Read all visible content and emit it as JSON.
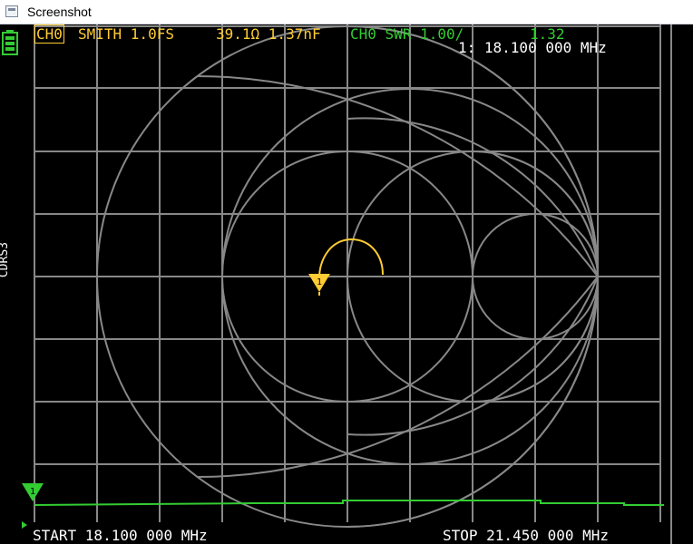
{
  "window": {
    "title": "Screenshot"
  },
  "header": {
    "trace_channel": "CH0",
    "trace_format": "SMITH 1.0FS",
    "trace_value": "39.1Ω 1.37nF",
    "swr_channel": "CH0",
    "swr_label": "SWR 1.00/",
    "swr_value": "1.32"
  },
  "marker": {
    "label": "1: 18.100 000 MHz",
    "number": "1"
  },
  "side_label": "CDRS3",
  "footer": {
    "start": "START 18.100 000 MHz",
    "stop": "STOP 21.450 000 MHz"
  },
  "colors": {
    "background": "#000000",
    "grid": "#888888",
    "trace_ch0": "#ffcc33",
    "trace_ch1": "#33cc33",
    "text": "#ffffff",
    "battery": "#33cc33"
  },
  "icons": [
    "battery-icon",
    "marker-triangle-icon"
  ]
}
